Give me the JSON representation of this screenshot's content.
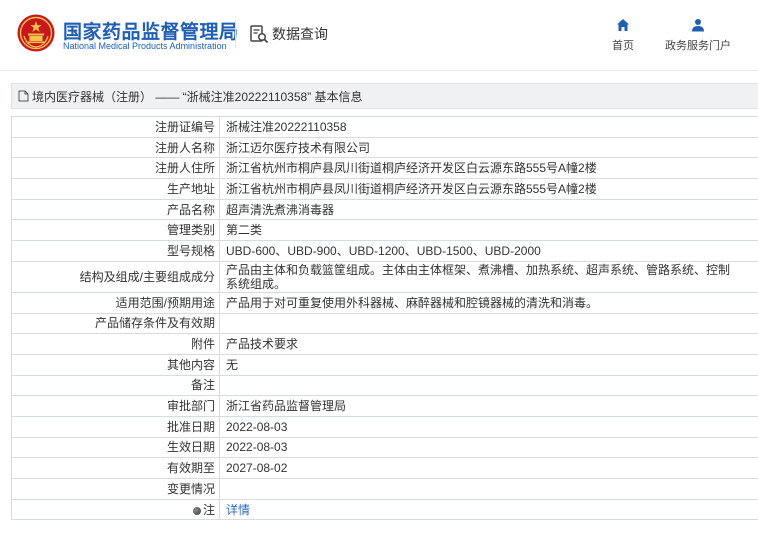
{
  "header": {
    "brand_cn": "国家药品监督管理局",
    "brand_en": "National Medical Products Administration",
    "data_query": "数据查询",
    "nav": [
      {
        "label": "首页",
        "icon": "home-icon"
      },
      {
        "label": "政务服务门户",
        "icon": "user-icon"
      }
    ],
    "brand_color": "#1f5eb3"
  },
  "breadcrumb": {
    "text": "境内医疗器械（注册） —— “浙械注准20222110358” 基本信息"
  },
  "table": {
    "rows": [
      {
        "label": "注册证编号",
        "value": "浙械注准20222110358"
      },
      {
        "label": "注册人名称",
        "value": "浙江迈尔医疗技术有限公司"
      },
      {
        "label": "注册人住所",
        "value": "浙江省杭州市桐庐县凤川街道桐庐经济开发区白云源东路555号A幢2楼"
      },
      {
        "label": "生产地址",
        "value": "浙江省杭州市桐庐县凤川街道桐庐经济开发区白云源东路555号A幢2楼"
      },
      {
        "label": "产品名称",
        "value": "超声清洗煮沸消毒器"
      },
      {
        "label": "管理类别",
        "value": "第二类"
      },
      {
        "label": "型号规格",
        "value": "UBD-600、UBD-900、UBD-1200、UBD-1500、UBD-2000"
      },
      {
        "label": "结构及组成/主要组成成分",
        "value": "产品由主体和负载篮筐组成。主体由主体框架、煮沸槽、加热系统、超声系统、管路系统、控制系统组成。"
      },
      {
        "label": "适用范围/预期用途",
        "value": "产品用于对可重复使用外科器械、麻醉器械和腔镜器械的清洗和消毒。"
      },
      {
        "label": "产品储存条件及有效期",
        "value": ""
      },
      {
        "label": "附件",
        "value": "产品技术要求"
      },
      {
        "label": "其他内容",
        "value": "无"
      },
      {
        "label": "备注",
        "value": ""
      },
      {
        "label": "审批部门",
        "value": "浙江省药品监督管理局"
      },
      {
        "label": "批准日期",
        "value": "2022-08-03"
      },
      {
        "label": "生效日期",
        "value": "2022-08-03"
      },
      {
        "label": "有效期至",
        "value": "2027-08-02"
      },
      {
        "label": "变更情况",
        "value": ""
      },
      {
        "label": "注",
        "value": "详情"
      }
    ]
  }
}
